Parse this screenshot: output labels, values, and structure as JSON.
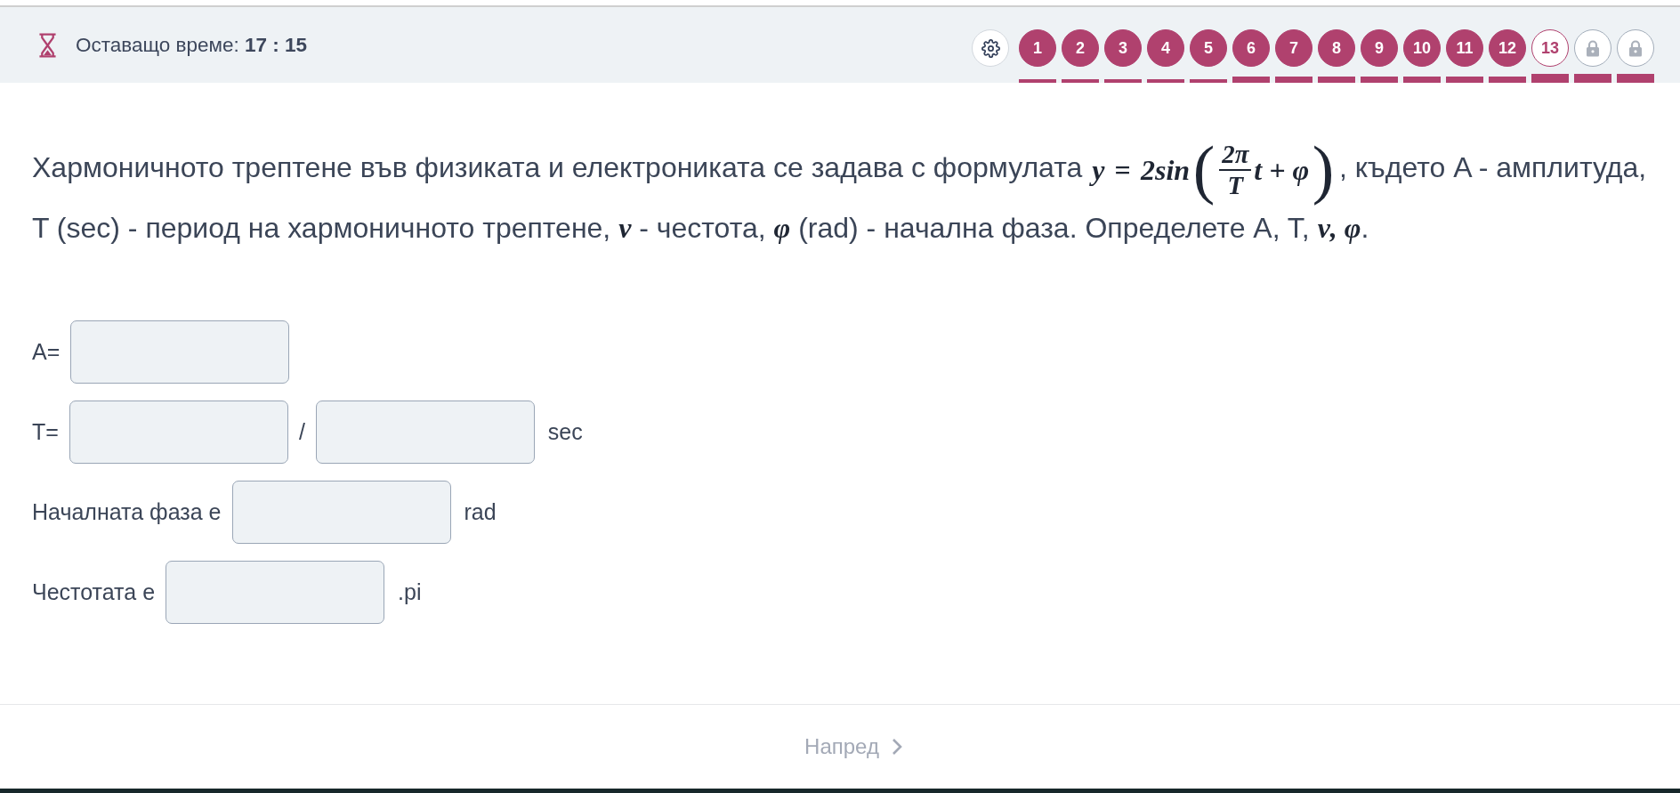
{
  "timer": {
    "text": "Оставащо време: **17 : 15**"
  },
  "question_nav": [
    {
      "kind": "number",
      "label": "1",
      "selected": false,
      "marker": {
        "kind": "short"
      }
    },
    {
      "kind": "number",
      "label": "2",
      "selected": false,
      "marker": {
        "kind": "short"
      }
    },
    {
      "kind": "number",
      "label": "3",
      "selected": false,
      "marker": {
        "kind": "short"
      }
    },
    {
      "kind": "number",
      "label": "4",
      "selected": false,
      "marker": {
        "kind": "short"
      }
    },
    {
      "kind": "number",
      "label": "5",
      "selected": false,
      "marker": {
        "kind": "short"
      }
    },
    {
      "kind": "number",
      "label": "6",
      "selected": false,
      "marker": {
        "kind": "medium"
      }
    },
    {
      "kind": "number",
      "label": "7",
      "selected": false,
      "marker": {
        "kind": "medium"
      }
    },
    {
      "kind": "number",
      "label": "8",
      "selected": false,
      "marker": {
        "kind": "medium"
      }
    },
    {
      "kind": "number",
      "label": "9",
      "selected": false,
      "marker": {
        "kind": "medium"
      }
    },
    {
      "kind": "number",
      "label": "10",
      "selected": false,
      "marker": {
        "kind": "medium"
      }
    },
    {
      "kind": "number",
      "label": "11",
      "selected": false,
      "marker": {
        "kind": "medium"
      }
    },
    {
      "kind": "number",
      "label": "12",
      "selected": false,
      "marker": {
        "kind": "medium"
      }
    },
    {
      "kind": "number",
      "label": "13",
      "selected": true,
      "marker": {
        "kind": "tall"
      }
    },
    {
      "kind": "locked",
      "selected": false,
      "marker": {
        "kind": "tall"
      }
    },
    {
      "kind": "locked",
      "selected": false,
      "marker": {
        "kind": "tall"
      }
    }
  ],
  "question": {
    "segments": [
      {
        "kind": "text",
        "text": "Хармоничното трептене във физиката и електрониката се задава с формулата "
      },
      {
        "kind": "formula",
        "lhs": "y",
        "eq": "=",
        "func": "2sin",
        "open": "(",
        "numerator": "2π",
        "denominator": "T",
        "tail": "t + φ",
        "close": ")"
      },
      {
        "kind": "text",
        "text": ", където A - амплитуда, T (sec) - период на хармоничното трептене, "
      },
      {
        "kind": "math",
        "text": "ν"
      },
      {
        "kind": "text",
        "text": " - честота, "
      },
      {
        "kind": "math",
        "text": "φ"
      },
      {
        "kind": "text",
        "text": " (rad) - начална фаза. Определете A, T, "
      },
      {
        "kind": "math",
        "text": "ν, φ"
      },
      {
        "kind": "text",
        "text": "."
      }
    ]
  },
  "answer_rows": [
    {
      "items": [
        {
          "kind": "label",
          "text": "A="
        },
        {
          "kind": "input"
        }
      ]
    },
    {
      "items": [
        {
          "kind": "label",
          "text": "T="
        },
        {
          "kind": "input"
        },
        {
          "kind": "separator",
          "text": "/"
        },
        {
          "kind": "input"
        },
        {
          "kind": "unit",
          "text": "sec"
        }
      ]
    },
    {
      "items": [
        {
          "kind": "label",
          "text": "Началната фаза е"
        },
        {
          "kind": "input"
        },
        {
          "kind": "unit",
          "text": "rad"
        }
      ]
    },
    {
      "items": [
        {
          "kind": "label",
          "text": "Честотата е"
        },
        {
          "kind": "input"
        },
        {
          "kind": "unit",
          "text": ".pi"
        }
      ]
    }
  ],
  "next_button": {
    "label": "Напред",
    "disabled": true
  }
}
